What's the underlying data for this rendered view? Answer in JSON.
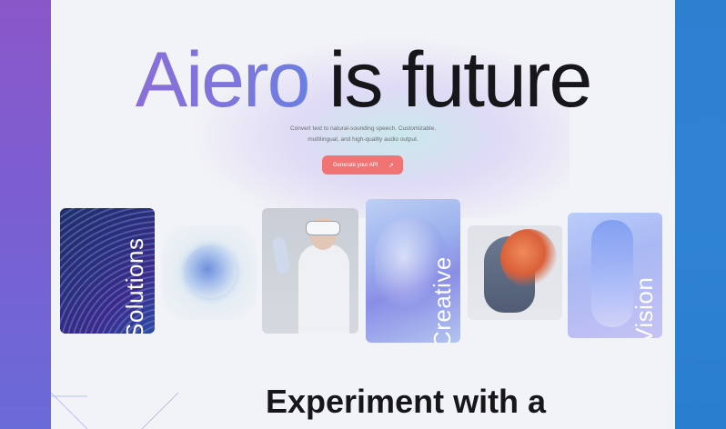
{
  "hero": {
    "title_brand": "Aiero",
    "title_rest": " is future",
    "subtitle_line1": "Convert text to natural-sounding speech. Customizable,",
    "subtitle_line2": "multilingual, and high-quality audio output.",
    "cta_label": "Generate your API",
    "cta_icon": "↗"
  },
  "gallery": {
    "labels": {
      "solutions": "Solutions",
      "creative": "Creative",
      "vision": "Vision"
    }
  },
  "section": {
    "title": "Experiment with a"
  },
  "colors": {
    "background": "#f2f3f6",
    "brand_gradient_start": "#8a6ed8",
    "brand_gradient_end": "#6a80e0",
    "cta": "#f07474",
    "left_panel": "#8a57c9",
    "right_panel": "#2f7fd1"
  }
}
